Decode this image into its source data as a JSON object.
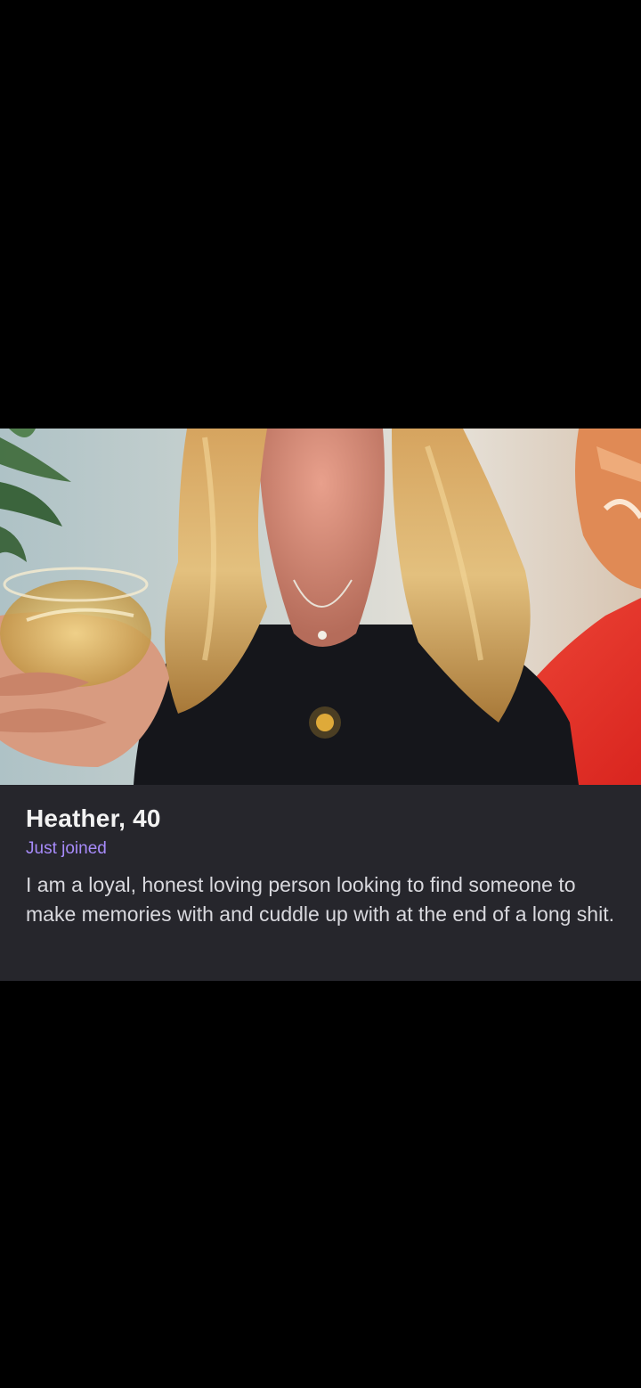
{
  "profile": {
    "name_age": "Heather, 40",
    "status": "Just joined",
    "bio": "I am a loyal, honest loving person looking to find someone to make memories with and cuddle up with at the end of a long shit."
  },
  "photo": {
    "icon": "profile-photo"
  },
  "colors": {
    "background": "#000000",
    "card": "#26262c",
    "name": "#f2f2f2",
    "status": "#a78bfa",
    "bio": "#d9d9de"
  }
}
